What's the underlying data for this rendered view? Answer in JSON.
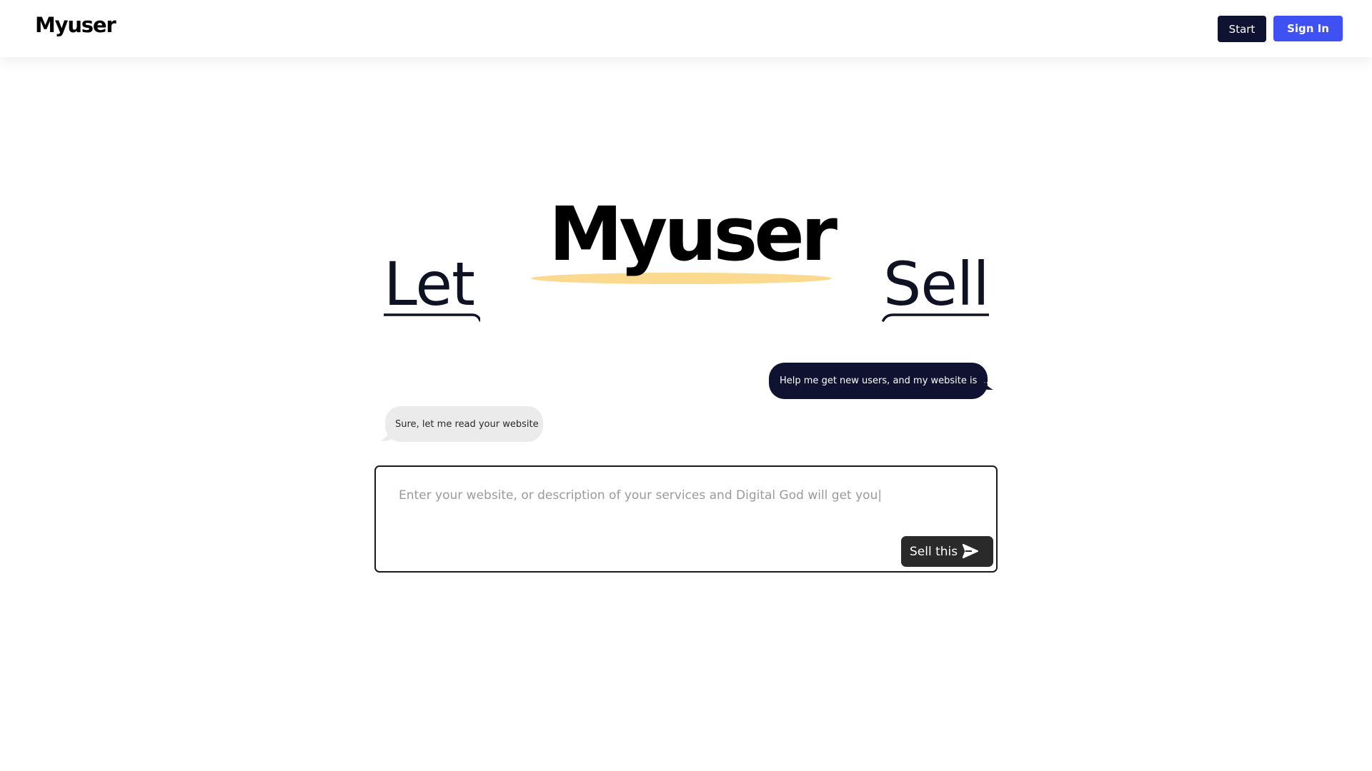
{
  "header": {
    "logo": "Myuser",
    "start_label": "Start",
    "signin_label": "Sign In"
  },
  "hero": {
    "word_left": "Let",
    "brand": "Myuser",
    "word_right": "Sell"
  },
  "chat": {
    "user_message": "Help me get new users, and my website is ...",
    "bot_message": "Sure, let me read your website"
  },
  "prompt": {
    "placeholder": "Enter your website, or description of your services and Digital God will get you|",
    "value": "",
    "submit_label": "Sell this"
  },
  "icons": {
    "send": "send-icon"
  },
  "colors": {
    "navy": "#0f1230",
    "signin_blue": "#3f51f2",
    "highlight_yellow": "#fbd98e",
    "bot_bubble_gray": "#ebebeb",
    "sell_button": "#2a2a2a"
  }
}
